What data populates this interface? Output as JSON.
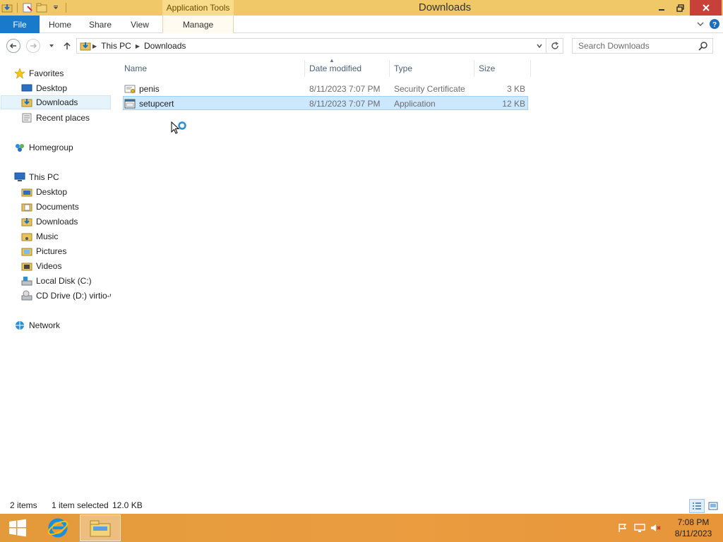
{
  "window": {
    "title": "Downloads",
    "context_tab_title": "Application Tools"
  },
  "ribbon": {
    "tabs": [
      {
        "label": "File"
      },
      {
        "label": "Home"
      },
      {
        "label": "Share"
      },
      {
        "label": "View"
      },
      {
        "label": "Manage"
      }
    ]
  },
  "address": {
    "crumbs": [
      "This PC",
      "Downloads"
    ]
  },
  "search": {
    "placeholder": "Search Downloads"
  },
  "navpane": {
    "items": [
      {
        "label": "Favorites",
        "icon": "star-icon"
      },
      {
        "label": "Desktop",
        "icon": "desktop-icon"
      },
      {
        "label": "Downloads",
        "icon": "downloads-folder-icon",
        "selected": true
      },
      {
        "label": "Recent places",
        "icon": "recent-places-icon"
      },
      {
        "label": "Homegroup",
        "icon": "homegroup-icon"
      },
      {
        "label": "This PC",
        "icon": "computer-icon"
      },
      {
        "label": "Desktop",
        "icon": "folder-icon"
      },
      {
        "label": "Documents",
        "icon": "folder-icon"
      },
      {
        "label": "Downloads",
        "icon": "downloads-folder-icon"
      },
      {
        "label": "Music",
        "icon": "folder-icon"
      },
      {
        "label": "Pictures",
        "icon": "folder-icon"
      },
      {
        "label": "Videos",
        "icon": "folder-icon"
      },
      {
        "label": "Local Disk (C:)",
        "icon": "local-disk-icon"
      },
      {
        "label": "CD Drive (D:) virtio-w",
        "icon": "cd-drive-icon"
      },
      {
        "label": "Network",
        "icon": "network-icon"
      }
    ]
  },
  "columns": [
    {
      "label": "Name"
    },
    {
      "label": "Date modified"
    },
    {
      "label": "Type"
    },
    {
      "label": "Size"
    }
  ],
  "files": [
    {
      "name": "penis",
      "date": "8/11/2023 7:07 PM",
      "type": "Security Certificate",
      "size": "3 KB",
      "icon": "certificate-icon",
      "selected": false
    },
    {
      "name": "setupcert",
      "date": "8/11/2023 7:07 PM",
      "type": "Application",
      "size": "12 KB",
      "icon": "application-icon",
      "selected": true
    }
  ],
  "status": {
    "item_count": "2 items",
    "selected": "1 item selected",
    "size": "12.0 KB"
  },
  "clock": {
    "time": "7:08 PM",
    "date": "8/11/2023"
  },
  "colors": {
    "titlebar": "#f0c868",
    "file_tab": "#1979ca",
    "selection": "#cce8ff",
    "close_button": "#c7403a",
    "taskbar": "#e8983c"
  }
}
